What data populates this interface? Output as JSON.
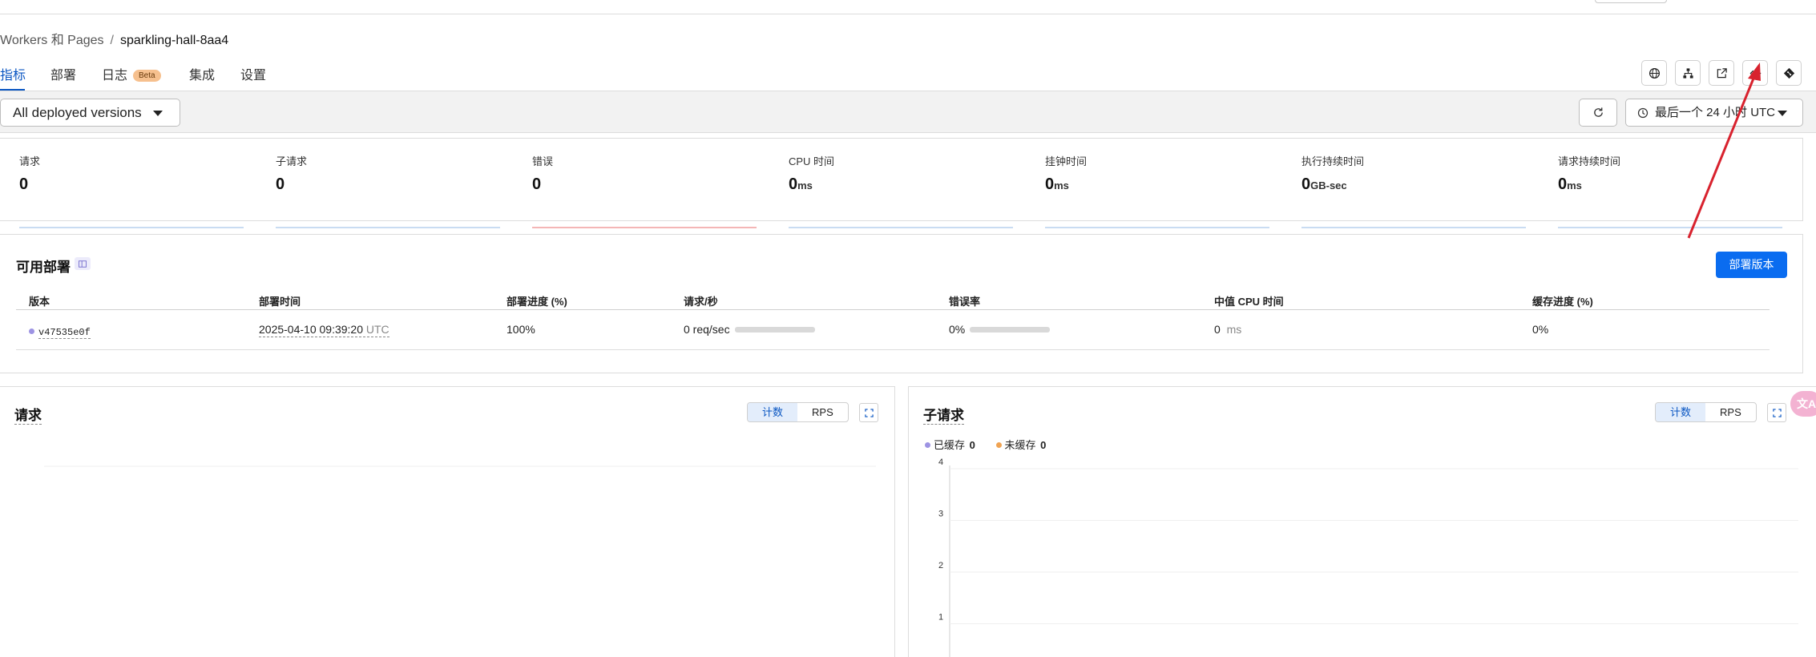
{
  "breadcrumb": {
    "parent": "Workers 和 Pages",
    "separator": "/",
    "current": "sparkling-hall-8aa4"
  },
  "tabs": [
    {
      "label": "指标",
      "active": true
    },
    {
      "label": "部署"
    },
    {
      "label": "日志",
      "badge": "Beta"
    },
    {
      "label": "集成"
    },
    {
      "label": "设置"
    }
  ],
  "header_icons": [
    "globe-icon",
    "sitemap-icon",
    "external-link-icon",
    "code-icon",
    "git-icon"
  ],
  "filters": {
    "versions": "All deployed versions",
    "time_range": "最后一个 24 小时 UTC"
  },
  "metrics": [
    {
      "label": "请求",
      "value": "0",
      "unit": ""
    },
    {
      "label": "子请求",
      "value": "0",
      "unit": ""
    },
    {
      "label": "错误",
      "value": "0",
      "unit": ""
    },
    {
      "label": "CPU 时间",
      "value": "0",
      "unit": "ms"
    },
    {
      "label": "挂钟时间",
      "value": "0",
      "unit": "ms"
    },
    {
      "label": "执行持续时间",
      "value": "0",
      "unit": "GB-sec"
    },
    {
      "label": "请求持续时间",
      "value": "0",
      "unit": "ms"
    }
  ],
  "deployments": {
    "title": "可用部署",
    "deploy_button": "部署版本",
    "columns": [
      "版本",
      "部署时间",
      "部署进度 (%)",
      "请求/秒",
      "错误率",
      "中值 CPU 时间",
      "缓存进度 (%)"
    ],
    "rows": [
      {
        "version": "v47535e0f",
        "deployed_at": "2025-04-10 09:39:20",
        "tz": "UTC",
        "progress": "100%",
        "rps": "0 req/sec",
        "error_rate": "0%",
        "cpu_value": "0",
        "cpu_unit": "ms",
        "cache": "0%"
      }
    ]
  },
  "charts": {
    "requests": {
      "title": "请求",
      "toggle": [
        "计数",
        "RPS"
      ]
    },
    "subrequests": {
      "title": "子请求",
      "toggle": [
        "计数",
        "RPS"
      ],
      "legend": [
        {
          "name": "已缓存",
          "value": "0",
          "color": "#9d93e3"
        },
        {
          "name": "未缓存",
          "value": "0",
          "color": "#f0a352"
        }
      ]
    }
  },
  "chart_data": {
    "type": "line",
    "title": "子请求",
    "yticks": [
      "4",
      "3",
      "2",
      "1"
    ],
    "ylim": [
      0,
      4
    ],
    "series": [
      {
        "name": "已缓存",
        "values": []
      },
      {
        "name": "未缓存",
        "values": []
      }
    ],
    "grid": true
  },
  "translate_badge": "文A"
}
